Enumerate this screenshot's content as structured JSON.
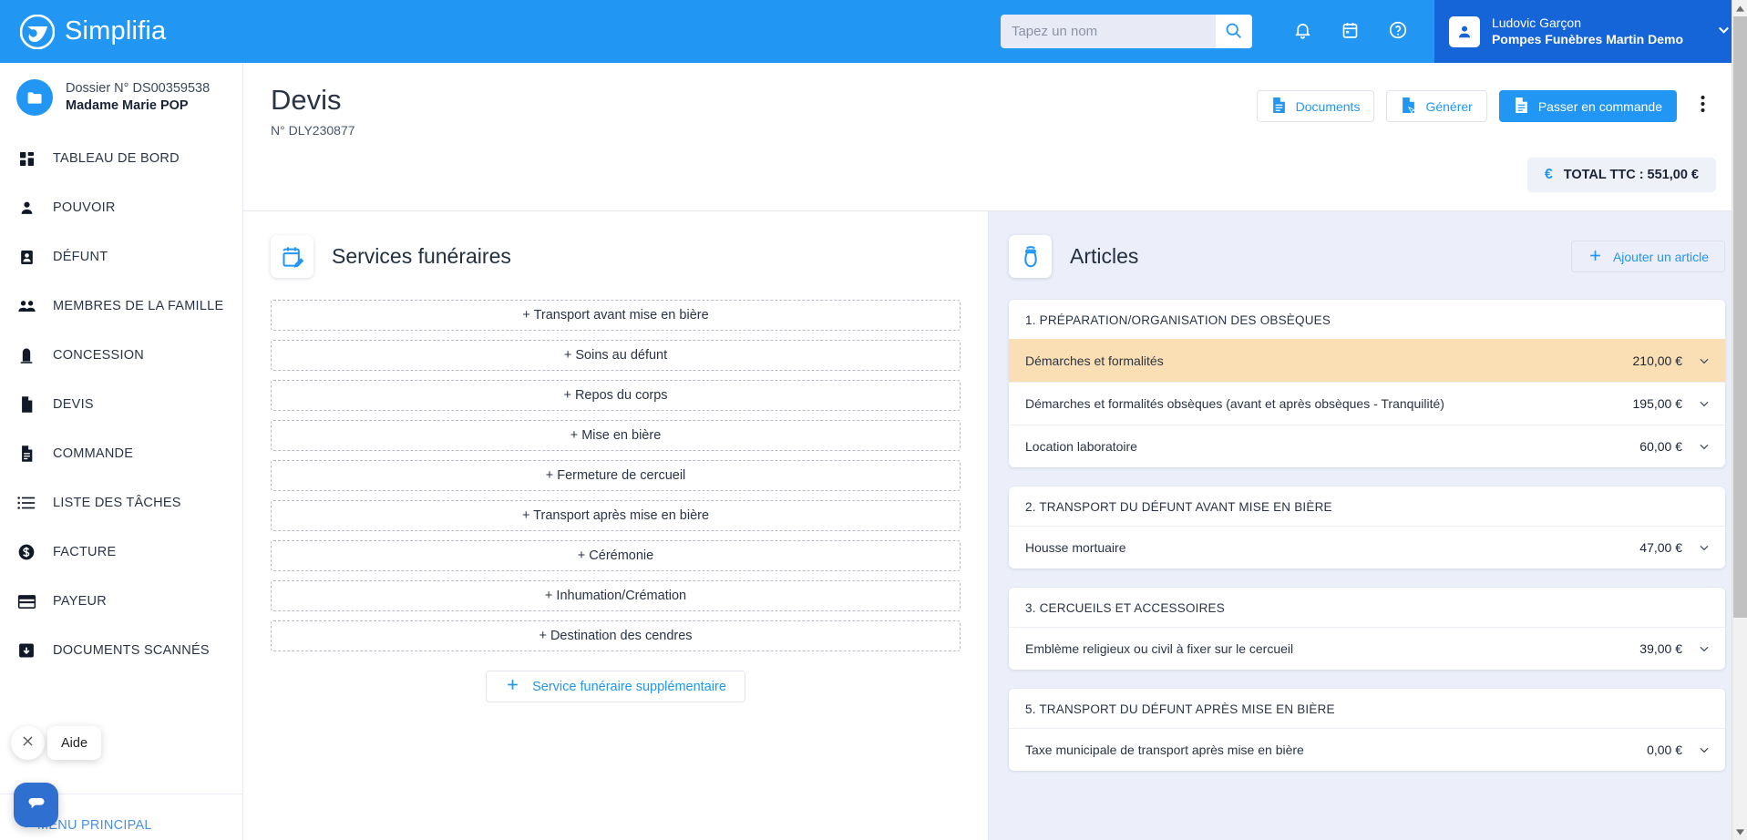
{
  "topbar": {
    "brand": "Simplifia",
    "search": {
      "placeholder": "Tapez un nom",
      "value": ""
    },
    "icons": {
      "search": "search-icon",
      "bell": "bell-icon",
      "calendar": "calendar-icon",
      "help": "help-circle-icon"
    },
    "user": {
      "name": "Ludovic Garçon",
      "org": "Pompes Funèbres Martin Demo"
    },
    "colors": {
      "bar": "#2196f3",
      "user_chip": "#1565d8"
    }
  },
  "sidebar": {
    "dossier": {
      "number": "Dossier N° DS00359538",
      "name": "Madame Marie POP"
    },
    "items": [
      {
        "label": "TABLEAU DE BORD",
        "icon": "dashboard-icon"
      },
      {
        "label": "POUVOIR",
        "icon": "person-icon"
      },
      {
        "label": "DÉFUNT",
        "icon": "id-card-icon"
      },
      {
        "label": "MEMBRES DE LA FAMILLE",
        "icon": "people-icon"
      },
      {
        "label": "CONCESSION",
        "icon": "headstone-icon"
      },
      {
        "label": "DEVIS",
        "icon": "document-icon"
      },
      {
        "label": "COMMANDE",
        "icon": "document-lines-icon"
      },
      {
        "label": "LISTE DES TÂCHES",
        "icon": "list-icon"
      },
      {
        "label": "FACTURE",
        "icon": "dollar-coin-icon"
      },
      {
        "label": "PAYEUR",
        "icon": "credit-card-icon"
      },
      {
        "label": "DOCUMENTS SCANNÉS",
        "icon": "scan-download-icon"
      }
    ],
    "menu_principal": "MENU PRINCIPAL",
    "chat": {
      "tooltip": "Aide",
      "close": "close-icon",
      "bubble": "chat-bubble-icon"
    }
  },
  "page": {
    "title": "Devis",
    "subtitle": "N° DLY230877",
    "actions": [
      {
        "label": "Documents",
        "icon": "document-icon",
        "style": "outline"
      },
      {
        "label": "Générer",
        "icon": "document-generate-icon",
        "style": "outline"
      },
      {
        "label": "Passer en commande",
        "icon": "document-icon",
        "style": "primary"
      }
    ],
    "kebab": "more-vertical-icon",
    "total": {
      "symbol": "€",
      "label": "TOTAL TTC : 551,00 €"
    }
  },
  "services": {
    "panel_title": "Services funéraires",
    "panel_icon": "calendar-edit-icon",
    "buttons": [
      "+ Transport avant mise en bière",
      "+ Soins au défunt",
      "+ Repos du corps",
      "+ Mise en bière",
      "+ Fermeture de cercueil",
      "+ Transport après mise en bière",
      "+ Cérémonie",
      "+ Inhumation/Crémation",
      "+ Destination des cendres"
    ],
    "extra_button": {
      "label": "Service funéraire supplémentaire",
      "icon": "plus-icon"
    }
  },
  "articles": {
    "panel_title": "Articles",
    "panel_icon": "urn-icon",
    "add_button": {
      "label": "Ajouter un article",
      "icon": "plus-icon"
    },
    "highlight_color": "#fadfb4",
    "groups": [
      {
        "title": "1. PRÉPARATION/ORGANISATION DES OBSÈQUES",
        "rows": [
          {
            "name": "Démarches et formalités",
            "price": "210,00 €",
            "highlighted": true
          },
          {
            "name": "Démarches et formalités obsèques (avant et après obsèques - Tranquilité)",
            "price": "195,00 €",
            "highlighted": false
          },
          {
            "name": "Location laboratoire",
            "price": "60,00 €",
            "highlighted": false
          }
        ]
      },
      {
        "title": "2. TRANSPORT DU DÉFUNT AVANT MISE EN BIÈRE",
        "rows": [
          {
            "name": "Housse mortuaire",
            "price": "47,00 €",
            "highlighted": false
          }
        ]
      },
      {
        "title": "3. CERCUEILS ET ACCESSOIRES",
        "rows": [
          {
            "name": "Emblème religieux ou civil à fixer sur le cercueil",
            "price": "39,00 €",
            "highlighted": false
          }
        ]
      },
      {
        "title": "5. TRANSPORT DU DÉFUNT APRÈS MISE EN BIÈRE",
        "rows": [
          {
            "name": "Taxe municipale de transport après mise en bière",
            "price": "0,00 €",
            "highlighted": false
          }
        ]
      }
    ]
  }
}
